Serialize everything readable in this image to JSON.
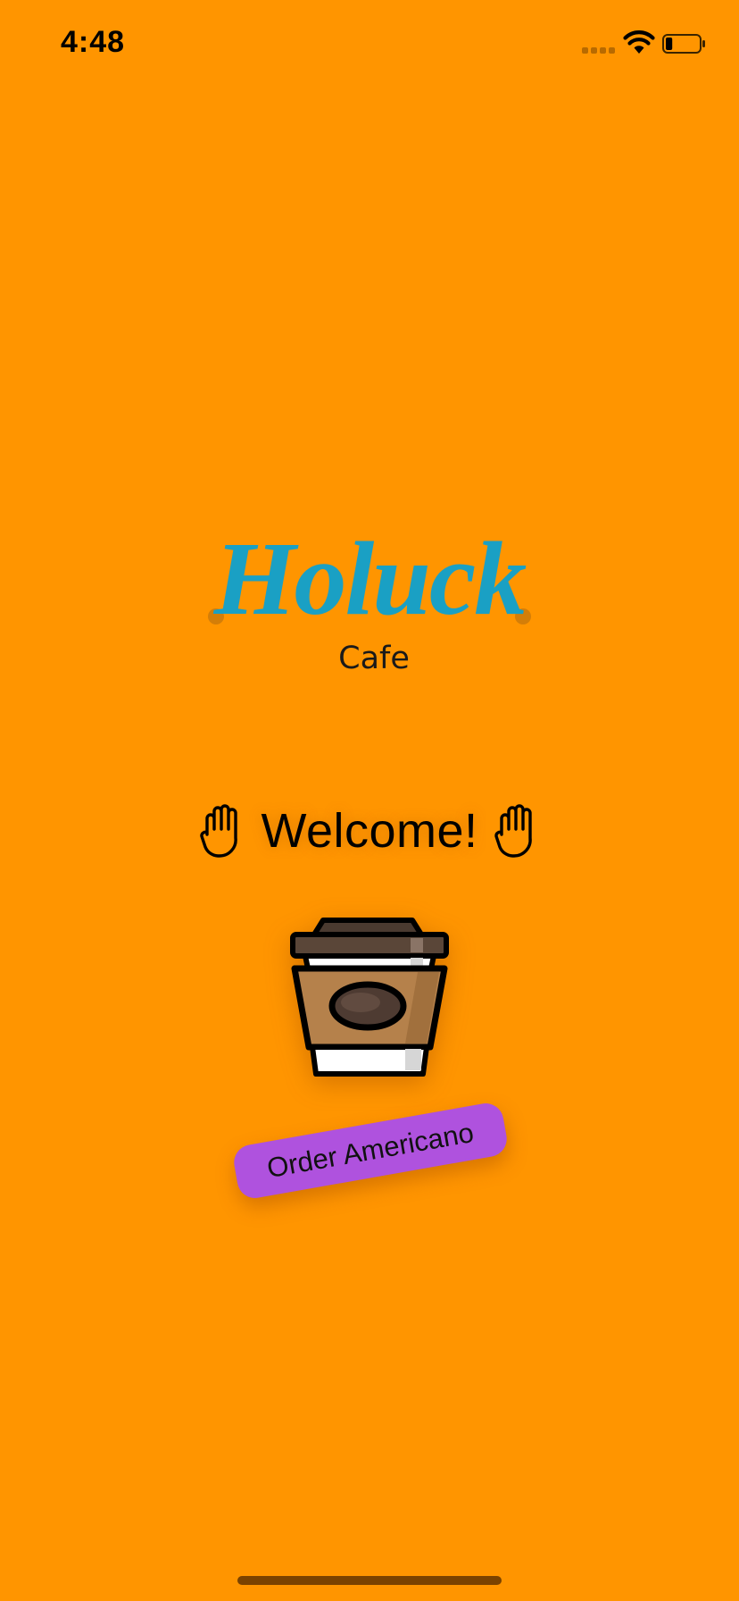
{
  "status_bar": {
    "time": "4:48",
    "icons": [
      "signal-icon",
      "wifi-icon",
      "battery-icon"
    ],
    "battery_level": 0.2
  },
  "logo": {
    "title": "Holuck",
    "subtitle": "Cafe"
  },
  "welcome": {
    "text": "Welcome!",
    "icon": "raised-hand-icon"
  },
  "hero_image": {
    "icon": "coffee-cup-icon"
  },
  "order_button": {
    "label": "Order Americano"
  },
  "colors": {
    "background": "#FF9500",
    "logo": "#1AA0C4",
    "button": "#AF52DE",
    "cup_body": "#B5814B",
    "cup_lid": "#4A3A30"
  }
}
